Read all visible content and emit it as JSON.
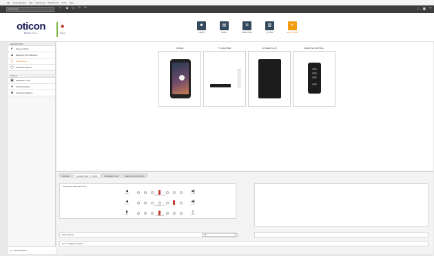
{
  "menubar": {
    "items": [
      "File",
      "Genie Medical",
      "Edit",
      "Instrument",
      "Preferences",
      "Tools",
      "Help"
    ]
  },
  "toolbar": {
    "patient_select": "[Unknown]",
    "icons": [
      "save-icon",
      "volume-icon",
      "mute-icon",
      "undo-icon",
      "redo-icon"
    ],
    "window_controls": [
      "minimize",
      "restore",
      "help"
    ]
  },
  "logo": {
    "name": "oticon",
    "sub": "MEDICAL"
  },
  "patient": {
    "label": "Patient"
  },
  "steps": [
    {
      "label": "CLIENT",
      "icon": "client-icon"
    },
    {
      "label": "FAMILY",
      "icon": "family-icon"
    },
    {
      "label": "SELECTION",
      "icon": "selection-icon"
    },
    {
      "label": "FITTING",
      "icon": "fitting-icon"
    },
    {
      "label": "END FITTING",
      "icon": "end-fitting-icon"
    }
  ],
  "sidebar": {
    "section1_title": "END FITTING",
    "items1": [
      {
        "label": "Save and Exit",
        "icon": "check-icon"
      },
      {
        "label": "Batteries and Indicators",
        "icon": "battery-icon"
      },
      {
        "label": "Accessories",
        "icon": "accessory-icon"
      },
      {
        "label": "Generate Reports",
        "icon": "report-icon"
      }
    ],
    "section2_title": "TOOLS",
    "items2": [
      {
        "label": "Medication Tool",
        "icon": "medication-icon"
      },
      {
        "label": "Technical Data",
        "icon": "technical-icon"
      },
      {
        "label": "Instrument History",
        "icon": "history-icon"
      }
    ],
    "footer": "Genie Medical"
  },
  "accessories": [
    {
      "title": "PHONE"
    },
    {
      "title": "TV ADAPTER"
    },
    {
      "title": "CONNECTCLIP"
    },
    {
      "title": "REMOTE CONTROL"
    }
  ],
  "bottom": {
    "tabs": [
      "PHONE",
      "TV ADAPTER / TV-BOX",
      "CONNECTCLIP",
      "REMOTE CONTROL"
    ],
    "panel_title": "GENERAL PERCEPTION",
    "sliders": [
      {
        "left": "Quieter",
        "right": "Louder",
        "caption": "TV Adapter loudness"
      },
      {
        "left": "Quieter",
        "right": "Louder",
        "caption": "Mic relative to TV"
      },
      {
        "left": "Bass",
        "right": "Treble",
        "caption": "Sound quality"
      }
    ],
    "power_boost_label": "Power Boost",
    "power_boost_value": "Off",
    "footer_text": "No TV Adapters paired"
  }
}
